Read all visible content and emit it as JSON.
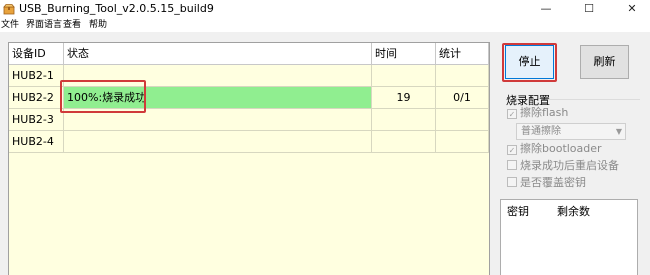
{
  "window": {
    "title": "USB_Burning_Tool_v2.0.5.15_build9",
    "icons": {
      "app": "box-icon",
      "minimize": "minimize-icon",
      "maximize": "maximize-icon",
      "close": "close-icon"
    },
    "minimize_glyph": "—",
    "maximize_glyph": "☐",
    "close_glyph": "✕"
  },
  "menu": [
    "文件",
    "界面语言",
    "查看",
    "帮助"
  ],
  "table": {
    "columns": [
      "设备ID",
      "状态",
      "时间",
      "统计"
    ],
    "rows": [
      {
        "id": "HUB2-1",
        "status": "",
        "time": "",
        "count": ""
      },
      {
        "id": "HUB2-2",
        "status": "100%:烧录成功",
        "time": "19",
        "count": "0/1"
      },
      {
        "id": "HUB2-3",
        "status": "",
        "time": "",
        "count": ""
      },
      {
        "id": "HUB2-4",
        "status": "",
        "time": "",
        "count": ""
      }
    ],
    "success_color": "#90ee90"
  },
  "buttons": {
    "stop": "停止",
    "refresh": "刷新"
  },
  "burn_config": {
    "title": "烧录配置",
    "erase_flash": {
      "label": "擦除flash",
      "checked": true,
      "enabled": false
    },
    "erase_mode": {
      "selected": "普通擦除"
    },
    "erase_bootloader": {
      "label": "擦除bootloader",
      "checked": true,
      "enabled": false
    },
    "reboot_after_burn": {
      "label": "烧录成功后重启设备",
      "checked": false,
      "enabled": false
    },
    "overwrite_key": {
      "label": "是否覆盖密钥",
      "checked": false,
      "enabled": false
    },
    "check_glyph": "✓"
  },
  "key_table": {
    "columns": [
      "密钥",
      "剩余数"
    ]
  },
  "highlight_color": "#d03a3a"
}
